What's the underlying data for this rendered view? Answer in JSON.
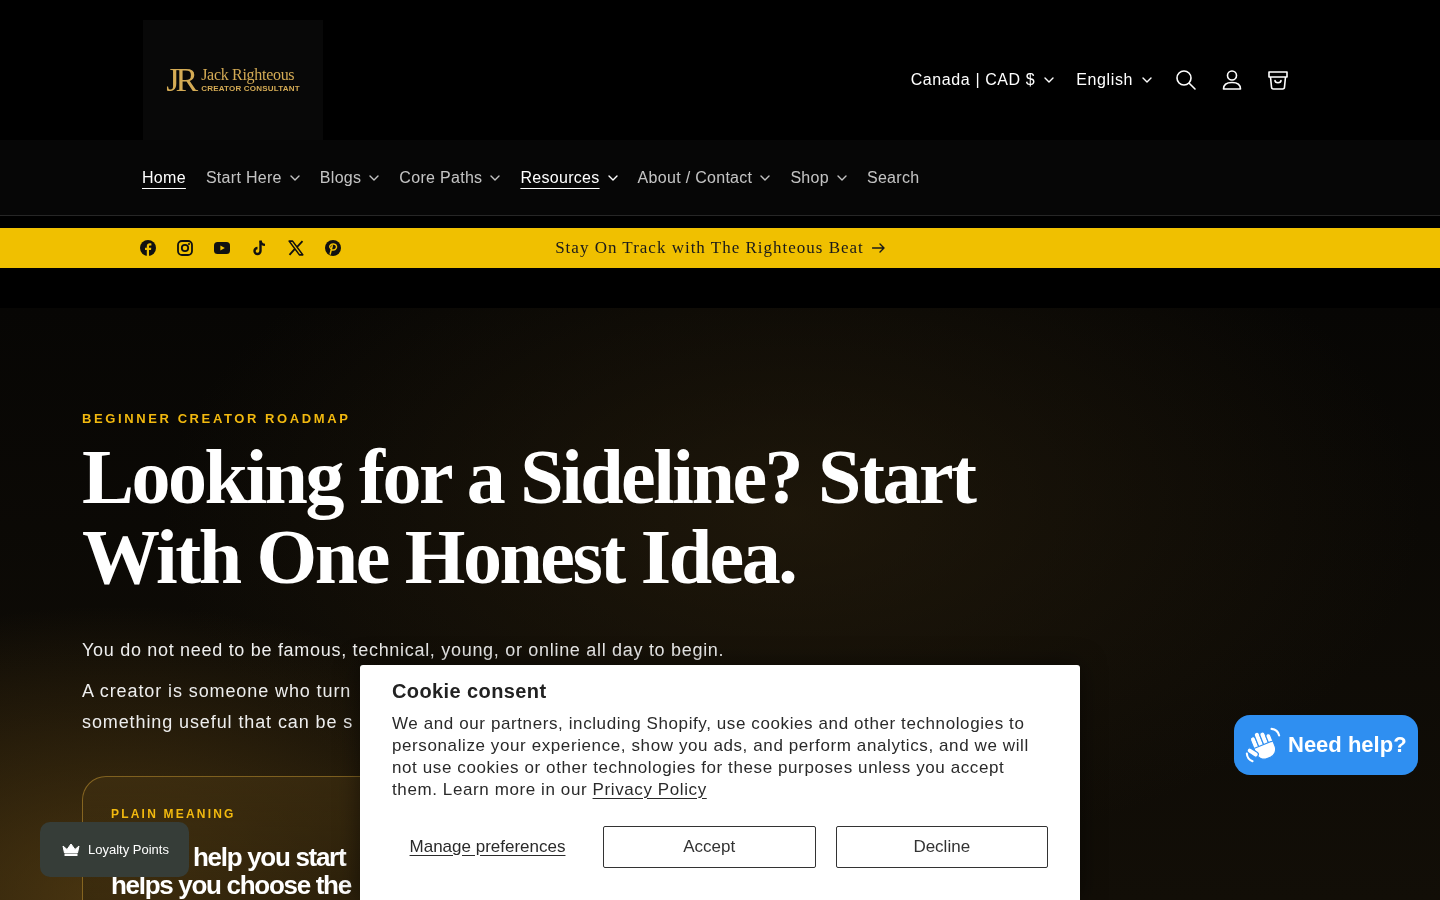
{
  "header": {
    "logo": {
      "monogram": "JR",
      "name": "Jack Righteous",
      "tagline": "CREATOR CONSULTANT"
    },
    "country_selector": "Canada | CAD $",
    "language_selector": "English"
  },
  "nav": [
    {
      "label": "Home",
      "kind": "link",
      "selected": true
    },
    {
      "label": "Start Here",
      "kind": "dropdown",
      "selected": false
    },
    {
      "label": "Blogs",
      "kind": "dropdown",
      "selected": false
    },
    {
      "label": "Core Paths",
      "kind": "dropdown",
      "selected": false
    },
    {
      "label": "Resources",
      "kind": "dropdown",
      "selected": true
    },
    {
      "label": "About / Contact",
      "kind": "dropdown",
      "selected": false
    },
    {
      "label": "Shop",
      "kind": "dropdown",
      "selected": false
    },
    {
      "label": "Search",
      "kind": "link",
      "selected": false
    }
  ],
  "announcement": {
    "text": "Stay On Track with The Righteous Beat"
  },
  "hero": {
    "eyebrow": "BEGINNER CREATOR ROADMAP",
    "title": "Looking for a Sideline? Start With One Honest Idea.",
    "intro": "You do not need to be famous, technical, young, or online all day to begin.",
    "detail_lines": [
      "A creator is someone who turn",
      "something useful that can be s"
    ],
    "card": {
      "eyebrow": "PLAIN MEANING",
      "title_lines": [
        "help you start",
        "helps you choose the"
      ]
    }
  },
  "cookie_banner": {
    "title": "Cookie consent",
    "body": "We and our partners, including Shopify, use cookies and other technologies to personalize your experience, show you ads, and perform analytics, and we will not use cookies or other technologies for these purposes unless you accept them. Learn more in our",
    "link": "Privacy Policy",
    "actions": [
      {
        "label": "Manage preferences",
        "kind": "link"
      },
      {
        "label": "Accept",
        "kind": "button"
      },
      {
        "label": "Decline",
        "kind": "button"
      }
    ]
  },
  "loyalty_button": {
    "label": "Loyalty Points"
  },
  "chat_button": {
    "label": "Need help?"
  }
}
